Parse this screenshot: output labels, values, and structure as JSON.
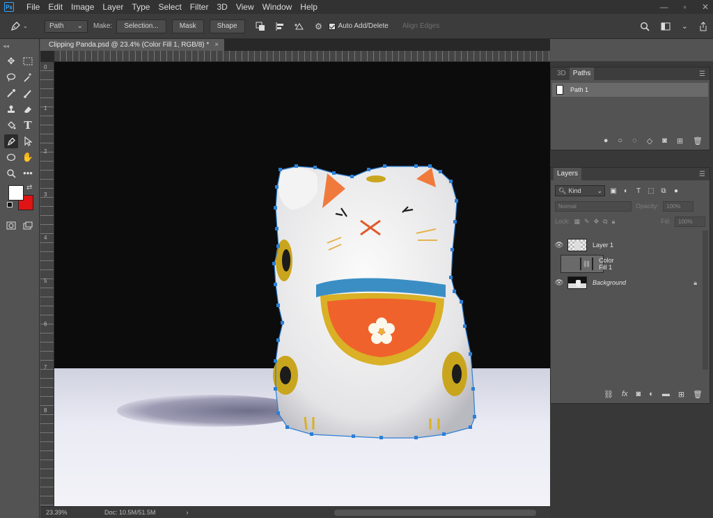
{
  "app": {
    "logo": "Ps"
  },
  "menu": {
    "items": [
      "File",
      "Edit",
      "Image",
      "Layer",
      "Type",
      "Select",
      "Filter",
      "3D",
      "View",
      "Window",
      "Help"
    ]
  },
  "window_controls": {
    "minimize": "—",
    "restore": "▫",
    "close": "✕"
  },
  "options": {
    "mode": "Path",
    "make_label": "Make:",
    "selection_btn": "Selection...",
    "mask_btn": "Mask",
    "shape_btn": "Shape",
    "auto_add_delete": "Auto Add/Delete",
    "align_edges": "Align Edges"
  },
  "document": {
    "tab_title": "Clipping Panda.psd @ 23.4% (Color Fill 1, RGB/8) *",
    "close": "×",
    "zoom": "23.39%",
    "doc_size": "Doc: 10.5M/51.5M"
  },
  "ruler_v": [
    "0",
    "1",
    "2",
    "3",
    "4",
    "5",
    "6",
    "7",
    "8"
  ],
  "paths_panel": {
    "tabs": [
      "3D",
      "Paths"
    ],
    "active_tab": "Paths",
    "items": [
      {
        "name": "Path 1"
      }
    ]
  },
  "layers_panel": {
    "title": "Layers",
    "filter_kind": "Kind",
    "blend_mode": "Normal",
    "opacity_label": "Opacity:",
    "opacity": "100%",
    "lock_label": "Lock:",
    "fill_label": "Fill:",
    "fill": "100%",
    "layers": [
      {
        "name": "Layer 1",
        "visible": true
      },
      {
        "name": "Color Fill 1",
        "visible": false,
        "selected": true
      },
      {
        "name": "Background",
        "visible": true,
        "locked": true
      }
    ]
  },
  "colors": {
    "foreground": "#ffffff",
    "background": "#e01414",
    "path_anchor": "#1e7fd8"
  }
}
